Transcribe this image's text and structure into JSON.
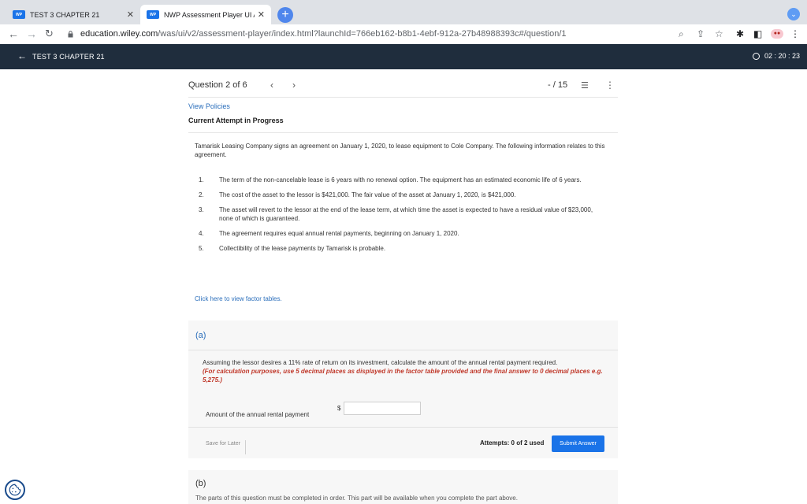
{
  "browser": {
    "tabs": [
      {
        "label": "TEST 3 CHAPTER 21",
        "favicon": "WP"
      },
      {
        "label": "NWP Assessment Player UI Ap",
        "favicon": "WP"
      }
    ],
    "new_tab": "+",
    "url_host": "education.wiley.com",
    "url_path": "/was/ui/v2/assessment-player/index.html?launchId=766eb162-b8b1-4ebf-912a-27b48988393c#/question/1"
  },
  "app": {
    "back_title": "TEST 3 CHAPTER 21",
    "timer": "02 : 20 : 23"
  },
  "question": {
    "number": "Question 2 of 6",
    "score": "- / 15",
    "view_policies": "View Policies",
    "attempt_status": "Current Attempt in Progress",
    "intro": "Tamarisk Leasing Company signs an agreement on January 1, 2020, to lease equipment to Cole Company. The following information relates to this agreement.",
    "items": [
      {
        "n": "1.",
        "text": "The term of the non-cancelable lease is 6 years with no renewal option. The equipment has an estimated economic life of 6 years."
      },
      {
        "n": "2.",
        "text": "The cost of the asset to the lessor is $421,000. The fair value of the asset at January 1, 2020, is $421,000."
      },
      {
        "n": "3.",
        "text": "The asset will revert to the lessor at the end of the lease term, at which time the asset is expected to have a residual value of $23,000, none of which is guaranteed."
      },
      {
        "n": "4.",
        "text": "The agreement requires equal annual rental payments, beginning on January 1, 2020."
      },
      {
        "n": "5.",
        "text": "Collectibility of the lease payments by Tamarisk is probable."
      }
    ],
    "factor_link": "Click here to view factor tables."
  },
  "part_a": {
    "label": "(a)",
    "prompt": "Assuming the lessor desires a 11% rate of return on its investment, calculate the amount of the annual rental payment required.",
    "note": "(For calculation purposes, use 5 decimal places as displayed in the factor table provided and the final answer to 0 decimal places e.g. 5,275.)",
    "amount_label": "Amount of the annual rental payment",
    "currency": "$",
    "amount_value": "",
    "save_label": "Save for Later",
    "attempts": "Attempts: 0 of 2 used",
    "submit_label": "Submit Answer"
  },
  "part_b": {
    "label": "(b)",
    "message": "The parts of this question must be completed in order. This part will be available when you complete the part above."
  }
}
